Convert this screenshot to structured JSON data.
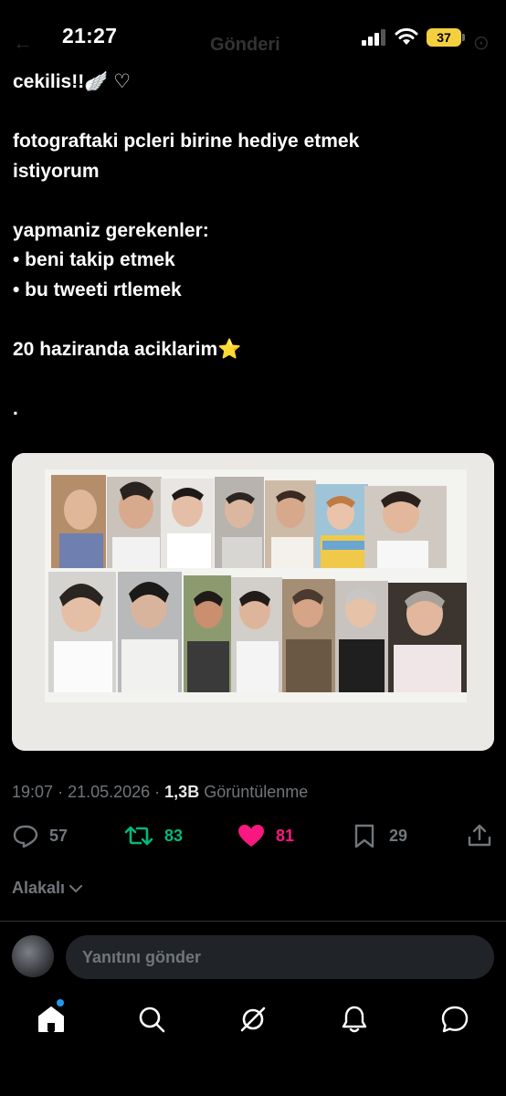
{
  "status_bar": {
    "time": "21:27",
    "battery": "37"
  },
  "header": {
    "title": "Gönderi"
  },
  "tweet": {
    "lines": [
      "cekilis!!🪽 ♡",
      "",
      "fotograftaki pcleri birine hediye etmek",
      "istiyorum",
      "",
      "yapmaniz gerekenler:",
      "• beni takip etmek",
      "• bu tweeti rtlemek",
      "",
      "20 haziranda aciklarim⭐",
      "",
      "."
    ]
  },
  "meta": {
    "time": "19:07",
    "date": "21.05.2026",
    "views_count": "1,3B",
    "views_label": "Görüntülenme"
  },
  "actions": {
    "replies": "57",
    "retweets": "83",
    "likes": "81",
    "bookmarks": "29"
  },
  "filter": {
    "label": "Alakalı"
  },
  "reply": {
    "placeholder": "Yanıtını gönder"
  },
  "colors": {
    "retweet": "#00ba7c",
    "like": "#f91880",
    "accent": "#1d9bf0",
    "muted": "#71767b"
  },
  "icons": [
    "reply-icon",
    "retweet-icon",
    "heart-icon",
    "bookmark-icon",
    "share-icon",
    "home-icon",
    "search-icon",
    "grok-icon",
    "notifications-icon",
    "messages-icon"
  ]
}
